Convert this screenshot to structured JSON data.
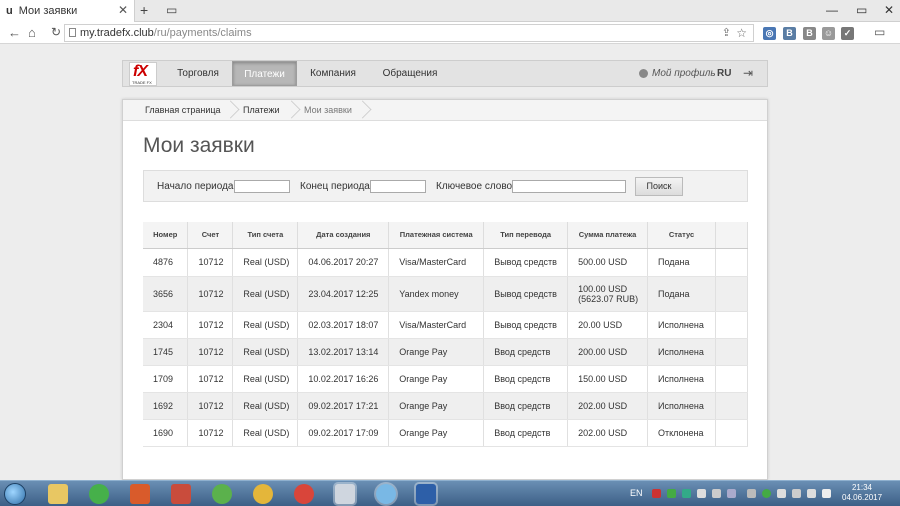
{
  "browser": {
    "tab_title": "Мои заявки",
    "tab_favicon": "u",
    "url_host": "my.tradefx.club",
    "url_path": "/ru/payments/claims"
  },
  "site": {
    "logo_text": "fX",
    "logo_sub": "TRADE FX",
    "menu": [
      "Торговля",
      "Платежи",
      "Компания",
      "Обращения"
    ],
    "active_menu": "Платежи",
    "profile_label": "Мой профиль",
    "lang": "RU"
  },
  "breadcrumbs": [
    "Главная страница",
    "Платежи",
    "Мои заявки"
  ],
  "page_title": "Мои заявки",
  "filters": {
    "start_label": "Начало периода:",
    "end_label": "Конец периода:",
    "keyword_label": "Ключевое слово:",
    "start_value": "",
    "end_value": "",
    "keyword_value": "",
    "search_button": "Поиск"
  },
  "table": {
    "headers": [
      "Номер",
      "Счет",
      "Тип счета",
      "Дата создания",
      "Платежная система",
      "Тип перевода",
      "Сумма платежа",
      "Статус",
      ""
    ],
    "rows": [
      {
        "number": "4876",
        "account": "10712",
        "type": "Real (USD)",
        "date": "04.06.2017 20:27",
        "system": "Visa/MasterCard",
        "transfer": "Вывод средств",
        "amount": "500.00 USD",
        "amount2": "",
        "status": "Подана"
      },
      {
        "number": "3656",
        "account": "10712",
        "type": "Real (USD)",
        "date": "23.04.2017 12:25",
        "system": "Yandex money",
        "transfer": "Вывод средств",
        "amount": "100.00 USD",
        "amount2": "(5623.07 RUB)",
        "status": "Подана"
      },
      {
        "number": "2304",
        "account": "10712",
        "type": "Real (USD)",
        "date": "02.03.2017 18:07",
        "system": "Visa/MasterCard",
        "transfer": "Вывод средств",
        "amount": "20.00 USD",
        "amount2": "",
        "status": "Исполнена"
      },
      {
        "number": "1745",
        "account": "10712",
        "type": "Real (USD)",
        "date": "13.02.2017 13:14",
        "system": "Orange Pay",
        "transfer": "Ввод средств",
        "amount": "200.00 USD",
        "amount2": "",
        "status": "Исполнена"
      },
      {
        "number": "1709",
        "account": "10712",
        "type": "Real (USD)",
        "date": "10.02.2017 16:26",
        "system": "Orange Pay",
        "transfer": "Ввод средств",
        "amount": "150.00 USD",
        "amount2": "",
        "status": "Исполнена"
      },
      {
        "number": "1692",
        "account": "10712",
        "type": "Real (USD)",
        "date": "09.02.2017 17:21",
        "system": "Orange Pay",
        "transfer": "Ввод средств",
        "amount": "202.00 USD",
        "amount2": "",
        "status": "Исполнена"
      },
      {
        "number": "1690",
        "account": "10712",
        "type": "Real (USD)",
        "date": "09.02.2017 17:09",
        "system": "Orange Pay",
        "transfer": "Ввод средств",
        "amount": "202.00 USD",
        "amount2": "",
        "status": "Отклонена"
      }
    ]
  },
  "taskbar": {
    "lang": "EN",
    "time": "21:34",
    "date": "04.06.2017",
    "icons": [
      "explorer-icon",
      "mail-icon",
      "media-player-icon",
      "puzzle-icon",
      "globe-icon",
      "mail2-icon",
      "chrome-icon",
      "monitor-icon",
      "network-icon",
      "word-icon"
    ]
  },
  "colors": {
    "brand_red": "#cc0000",
    "active_menu": "#b7b7b7",
    "taskbar": "#3c5f86"
  }
}
